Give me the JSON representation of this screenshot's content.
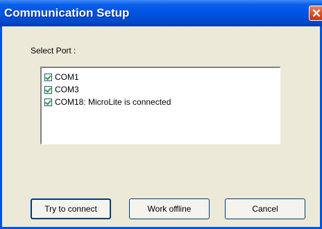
{
  "window": {
    "title": "Communication Setup",
    "close_icon": "close-icon"
  },
  "port": {
    "label": "Select Port :",
    "items": [
      {
        "label": "COM1",
        "checked": true
      },
      {
        "label": "COM3",
        "checked": true
      },
      {
        "label": "COM18: MicroLite is connected",
        "checked": true
      }
    ]
  },
  "buttons": {
    "connect": "Try to connect",
    "offline": "Work offline",
    "cancel": "Cancel"
  },
  "colors": {
    "title_bar": "#0054e3",
    "dialog_bg": "#ece9d8",
    "close_button": "#d9532a"
  }
}
